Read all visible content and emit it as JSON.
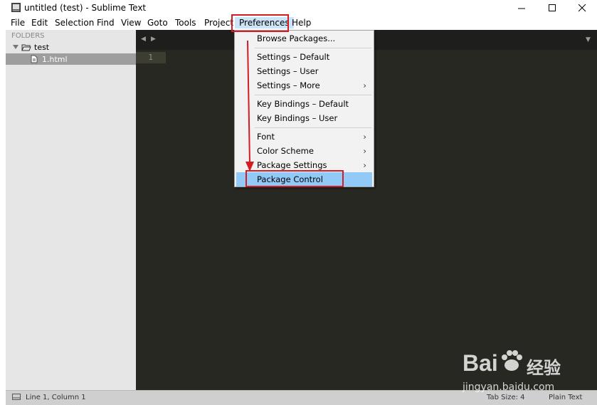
{
  "window": {
    "title": "untitled (test) - Sublime Text"
  },
  "menubar": {
    "items": [
      "File",
      "Edit",
      "Selection",
      "Find",
      "View",
      "Goto",
      "Tools",
      "Project",
      "Preferences",
      "Help"
    ]
  },
  "sidebar": {
    "folders_label": "FOLDERS",
    "folder_name": "test",
    "file_name": "1.html"
  },
  "editor": {
    "line_number": "1"
  },
  "preferences_menu": {
    "items": [
      {
        "label": "Browse Packages..."
      },
      {
        "label": "Settings – Default"
      },
      {
        "label": "Settings – User"
      },
      {
        "label": "Settings – More",
        "arrow": "›"
      },
      {
        "label": "Key Bindings – Default"
      },
      {
        "label": "Key Bindings – User"
      },
      {
        "label": "Font",
        "arrow": "›"
      },
      {
        "label": "Color Scheme",
        "arrow": "›"
      },
      {
        "label": "Package Settings",
        "arrow": "›"
      },
      {
        "label": "Package Control"
      }
    ]
  },
  "statusbar": {
    "position": "Line 1, Column 1",
    "tab_size": "Tab Size: 4",
    "syntax": "Plain Text"
  },
  "watermark": {
    "brand": "Bai",
    "brand2": "经验",
    "url": "jingyan.baidu.com"
  },
  "colors": {
    "highlight_red": "#d41c24",
    "menu_highlight": "#91c9f7",
    "editor_bg": "#272822"
  }
}
